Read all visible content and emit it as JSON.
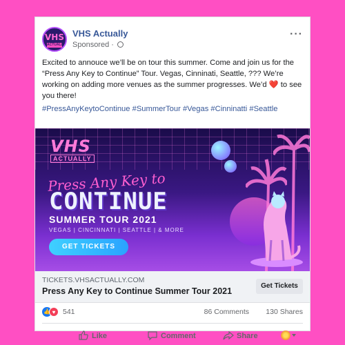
{
  "post": {
    "page_name": "VHS Actually",
    "sponsored": "Sponsored",
    "avatar_text": "VHS",
    "avatar_sub": "ACTUALLY",
    "more_icon": "more-horizontal-icon",
    "body": "Excited to annouce we’ll be on tour this summer.  Come and join us for the “Press Any Key to Continue” Tour. Vegas, Cinninati, Seattle, ??? We’re working on adding more venues as the summer progresses. We’d",
    "body_end": " to see you there!",
    "hashtags": "#PressAnyKeytoContinue #SummerTour #Vegas #Cinninatti #Seattle"
  },
  "banner": {
    "logo_top": "VHS",
    "logo_bottom": "ACTUALLY",
    "script_line": "Press Any Key to",
    "headline": "CONTINUE",
    "tour": "SUMMER TOUR 2021",
    "cities": "VEGAS | CINCINNATI | SEATTLE | & MORE",
    "cta": "GET TICKETS"
  },
  "link": {
    "domain": "TICKETS.VHSACTUALLY.COM",
    "title": "Press Any Key to Continue Summer Tour 2021",
    "button": "Get Tickets"
  },
  "stats": {
    "reactions": "541",
    "comments": "86 Comments",
    "shares": "130 Shares"
  },
  "actions": {
    "like": "Like",
    "comment": "Comment",
    "share": "Share"
  },
  "colors": {
    "background": "#ff4fc3",
    "link_blue": "#385898",
    "like_blue": "#1877f2",
    "love_red": "#f33e58"
  }
}
